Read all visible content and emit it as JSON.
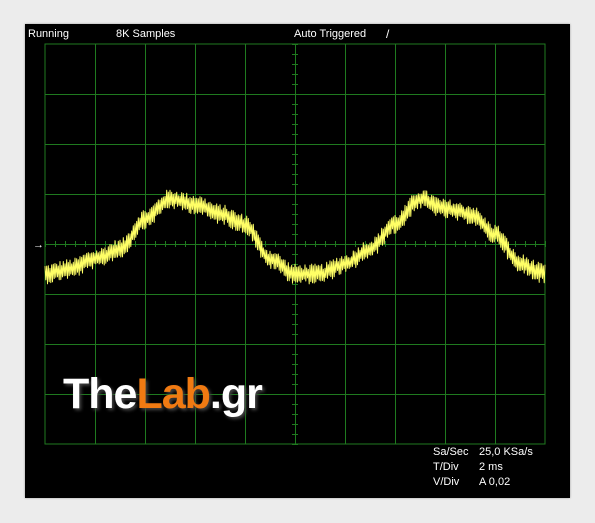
{
  "header": {
    "status": "Running",
    "samples": "8K Samples",
    "trigger": "Auto Triggered",
    "trigger_slope": "/"
  },
  "marker": {
    "symbol": "→"
  },
  "readouts": [
    {
      "key": "Sa/Sec",
      "value": "25,0 KSa/s"
    },
    {
      "key": "T/Div",
      "value": "2 ms"
    },
    {
      "key": "V/Div",
      "value": "A 0,02"
    }
  ],
  "watermark": {
    "part1": "The",
    "part2": "Lab",
    "part3": ".gr"
  },
  "colors": {
    "screen": "#000000",
    "grid": "#1f7a1f",
    "trace": "#ffff66",
    "text": "#ffffff",
    "watermark_accent": "#f07a12"
  },
  "chart_data": {
    "type": "line",
    "grid": {
      "horizontal_divisions": 10,
      "vertical_divisions": 8
    },
    "time_per_div": "2 ms",
    "volts_per_div": "0,02",
    "x_divisions": [
      0,
      0.5,
      1.0,
      1.5,
      2.0,
      2.5,
      3.0,
      3.5,
      4.0,
      4.5,
      5.0,
      5.5,
      6.0,
      6.5,
      7.0,
      7.5,
      8.0,
      8.5,
      9.0,
      9.5,
      10.0
    ],
    "y_divisions": [
      -0.6,
      -0.5,
      -0.3,
      -0.1,
      0.5,
      0.9,
      0.8,
      0.6,
      0.4,
      -0.3,
      -0.6,
      -0.6,
      -0.4,
      -0.1,
      0.4,
      0.9,
      0.7,
      0.6,
      0.2,
      -0.4,
      -0.6
    ],
    "noise_divisions": 0.2
  }
}
